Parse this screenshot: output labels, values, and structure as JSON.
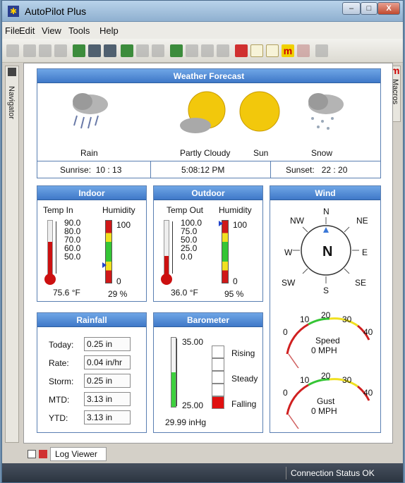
{
  "window": {
    "title": "AutoPilot Plus",
    "minimize_label": "–",
    "maximize_label": "□",
    "close_label": "X"
  },
  "menu": [
    {
      "label": "File"
    },
    {
      "label": "Edit"
    },
    {
      "label": "View"
    },
    {
      "label": "Tools"
    },
    {
      "label": "Help"
    }
  ],
  "sidebars": {
    "left_label": "Navigator",
    "right_label": "Macros",
    "right_logo": "m"
  },
  "forecast": {
    "title": "Weather Forecast",
    "items": [
      {
        "label": "Rain",
        "icon": "rain-cloud-icon"
      },
      {
        "label": "Partly Cloudy",
        "icon": "partly-cloudy-icon"
      },
      {
        "label": "Sun",
        "icon": "sun-icon"
      },
      {
        "label": "Snow",
        "icon": "snow-cloud-icon"
      }
    ],
    "sunrise": "Sunrise:  10 : 13",
    "time": "5:08:12 PM",
    "sunset": "Sunset:   22 : 20"
  },
  "indoor": {
    "title": "Indoor",
    "temp_label": "Temp In",
    "humidity_label": "Humidity",
    "temp_ticks": [
      "90.0",
      "80.0",
      "70.0",
      "60.0",
      "50.0"
    ],
    "humidity_max": "100",
    "humidity_min": "0",
    "temp_value": "75.6 °F",
    "humidity_value": "29 %",
    "temp_fill": 0.62,
    "humidity_fill": 0.29
  },
  "outdoor": {
    "title": "Outdoor",
    "temp_label": "Temp Out",
    "humidity_label": "Humidity",
    "temp_ticks": [
      "100.0",
      "75.0",
      "50.0",
      "25.0",
      "0.0"
    ],
    "humidity_max": "100",
    "humidity_min": "0",
    "temp_value": "36.0 °F",
    "humidity_value": "95 %",
    "temp_fill": 0.36,
    "humidity_fill": 0.95
  },
  "wind": {
    "title": "Wind",
    "directions": {
      "n": "N",
      "ne": "NE",
      "e": "E",
      "se": "SE",
      "s": "S",
      "sw": "SW",
      "w": "W",
      "nw": "NW"
    },
    "heading": "N",
    "speed_gauge": {
      "ticks": [
        "0",
        "10",
        "20",
        "30",
        "40"
      ],
      "label": "Speed",
      "value": "0 MPH"
    },
    "gust_gauge": {
      "ticks": [
        "0",
        "10",
        "20",
        "30",
        "40"
      ],
      "label": "Gust",
      "value": "0 MPH"
    }
  },
  "rainfall": {
    "title": "Rainfall",
    "rows": [
      {
        "label": "Today:",
        "value": "0.25 in"
      },
      {
        "label": "Rate:",
        "value": "0.04 in/hr"
      },
      {
        "label": "Storm:",
        "value": "0.25 in"
      },
      {
        "label": "MTD:",
        "value": "3.13 in"
      },
      {
        "label": "YTD:",
        "value": "3.13 in"
      }
    ]
  },
  "barometer": {
    "title": "Barometer",
    "max": "35.00",
    "min": "25.00",
    "value": "29.99 inHg",
    "fill": 0.5,
    "trend": [
      {
        "label": "Rising"
      },
      {
        "label": "Steady"
      },
      {
        "label": "Falling"
      }
    ],
    "active_trend": "Falling"
  },
  "tabs": {
    "log_viewer": "Log Viewer"
  },
  "status": {
    "text": "Connection Status OK"
  },
  "colors": {
    "panel_header": "#4f88d6",
    "red": "#d01818",
    "green": "#35c535",
    "yellow": "#f0e020"
  }
}
